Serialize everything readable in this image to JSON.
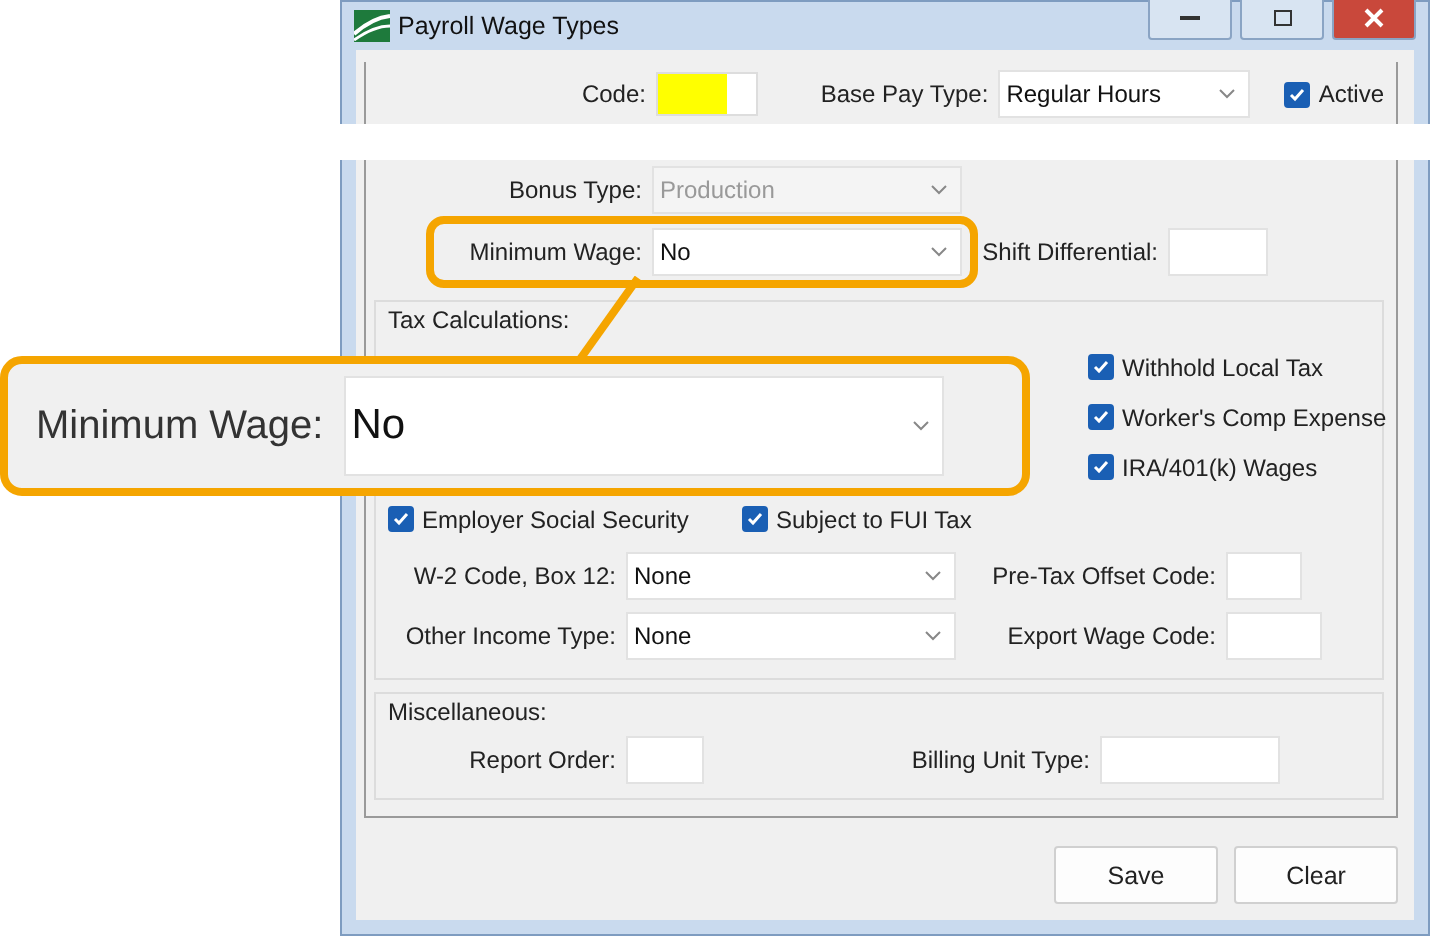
{
  "window": {
    "title": "Payroll Wage Types"
  },
  "header": {
    "code": {
      "label": "Code:"
    },
    "base_pay_type": {
      "label": "Base Pay Type:",
      "value": "Regular Hours"
    },
    "active": {
      "label": "Active",
      "checked": true
    }
  },
  "bonus_type": {
    "label": "Bonus Type:",
    "value": "Production",
    "disabled": true
  },
  "minimum_wage": {
    "label": "Minimum Wage:",
    "value": "No",
    "highlighted": true
  },
  "shift_differential": {
    "label": "Shift Differential:"
  },
  "tax_calculations": {
    "title": "Tax Calculations:",
    "side_checkboxes": [
      {
        "label": "Withhold Local Tax",
        "checked": true
      },
      {
        "label": "Worker's Comp Expense",
        "checked": true
      },
      {
        "label": "IRA/401(k) Wages",
        "checked": true
      }
    ],
    "row_checkboxes": [
      {
        "label": "Employer Social Security",
        "checked": true
      },
      {
        "label": "Subject to FUI Tax",
        "checked": true
      }
    ],
    "rows": [
      {
        "label": "W-2 Code, Box 12:",
        "value": "None",
        "side_label": "Pre-Tax Offset Code:"
      },
      {
        "label": "Other Income Type:",
        "value": "None",
        "side_label": "Export Wage Code:"
      }
    ]
  },
  "miscellaneous": {
    "title": "Miscellaneous:",
    "report_order": {
      "label": "Report Order:"
    },
    "billing_unit_type": {
      "label": "Billing Unit Type:"
    }
  },
  "buttons": [
    "Save",
    "Clear"
  ],
  "callout": {
    "label": "Minimum Wage:",
    "value": "No"
  }
}
